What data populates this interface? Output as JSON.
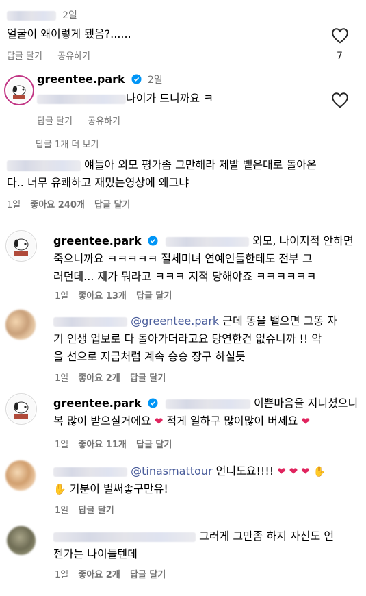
{
  "comments": [
    {
      "id": "c1",
      "time": "2일",
      "text": "얼굴이 왜이렇게 됐음?......",
      "reply": "답글 달기",
      "share": "공유하기",
      "like_count": "7"
    },
    {
      "id": "c2",
      "username": "greentee.park",
      "time": "2일",
      "text": "나이가 드니까요 ㅋ",
      "reply": "답글 달기",
      "share": "공유하기"
    }
  ],
  "more_replies": "답글 1개 더 보기",
  "thread": [
    {
      "id": "t1",
      "text_line1": "얘들아 외모 평가좀 그만해라 제발 뱉은대로 돌아온",
      "text_line2": "다.. 너무 유쾌하고 재밌는영상에 왜그냐",
      "time": "1일",
      "likes": "좋아요 240개",
      "reply": "답글 달기"
    },
    {
      "id": "t2",
      "username": "greentee.park",
      "text_line1": "외모, 나이지적 안하면",
      "text_line2": "죽으니까요 ㅋㅋㅋㅋㅋ 절세미녀 연예인들한테도 전부 그",
      "text_line3": "러던데... 제가 뭐라고 ㅋㅋㅋ 지적 당해야죠 ㅋㅋㅋㅋㅋㅋ",
      "time": "1일",
      "likes": "좋아요 13개",
      "reply": "답글 달기"
    },
    {
      "id": "t3",
      "mention": "@greentee.park",
      "text_line1": "근데 똥을 뱉으면 그똥 자",
      "text_line2": "기 인생 업보로 다 돌아가더라고요 당연한건 없슈니까 !! 악",
      "text_line3": "을 선으로 지금처럼 계속 승승 장구 하실듯",
      "time": "1일",
      "likes": "좋아요 2개",
      "reply": "답글 달기"
    },
    {
      "id": "t4",
      "username": "greentee.park",
      "text_line1": "이쁜마음을 지니셨으니",
      "text_line2a": "복 많이 받으실거에요",
      "text_line2b": "적게 일하구 많이많이 버세요",
      "time": "1일",
      "likes": "좋아요 11개",
      "reply": "답글 달기"
    },
    {
      "id": "t5",
      "mention": "@tinasmattour",
      "text_line1": "언니도요!!!!",
      "text_line2": "기분이 벌써좋구만유!",
      "time": "1일",
      "reply": "답글 달기"
    },
    {
      "id": "t6",
      "text_line1": "그러게 그만좀 하지 자신도 언",
      "text_line2": "젠가는 나이들텐데",
      "time": "1일",
      "likes": "좋아요 2개",
      "reply": "답글 달기"
    }
  ],
  "icons": {
    "heart": "heart-outline-icon",
    "verified": "verified-badge-icon"
  },
  "colors": {
    "verified": "#0095f6",
    "heart_emoji": "#e0245e",
    "mention": "#4a5d9b",
    "meta": "#737373"
  }
}
